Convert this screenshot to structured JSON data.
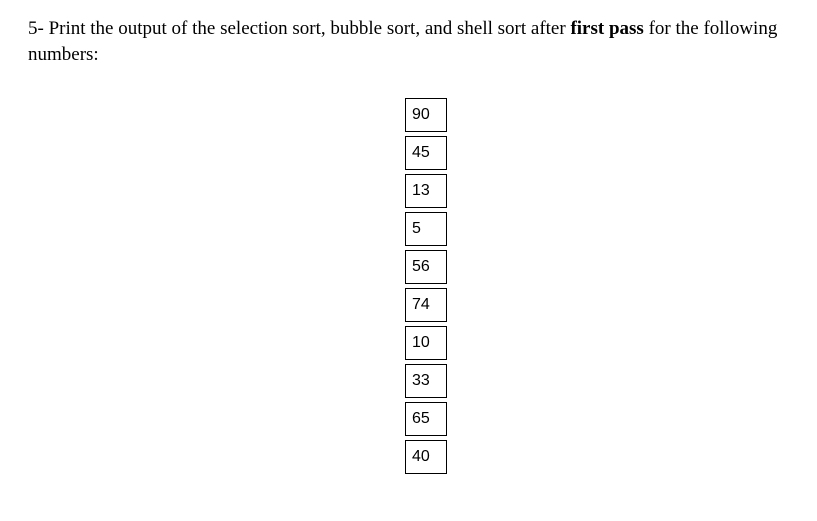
{
  "question": {
    "prefix": "5- ",
    "text_before_bold": "Print the output of the selection sort, bubble sort, and shell sort after ",
    "bold_text": "first pass",
    "text_after_bold": " for the following numbers:"
  },
  "numbers": [
    "90",
    "45",
    "13",
    "5",
    "56",
    "74",
    "10",
    "33",
    "65",
    "40"
  ]
}
